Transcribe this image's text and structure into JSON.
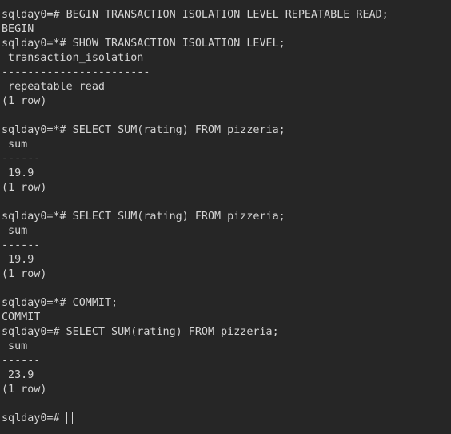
{
  "terminal": {
    "lines": [
      "sqlday0=# BEGIN TRANSACTION ISOLATION LEVEL REPEATABLE READ;",
      "BEGIN",
      "sqlday0=*# SHOW TRANSACTION ISOLATION LEVEL;",
      " transaction_isolation",
      "-----------------------",
      " repeatable read",
      "(1 row)",
      "",
      "sqlday0=*# SELECT SUM(rating) FROM pizzeria;",
      " sum",
      "------",
      " 19.9",
      "(1 row)",
      "",
      "sqlday0=*# SELECT SUM(rating) FROM pizzeria;",
      " sum",
      "------",
      " 19.9",
      "(1 row)",
      "",
      "sqlday0=*# COMMIT;",
      "COMMIT",
      "sqlday0=# SELECT SUM(rating) FROM pizzeria;",
      " sum",
      "------",
      " 23.9",
      "(1 row)",
      ""
    ],
    "prompt": "sqlday0=# "
  }
}
